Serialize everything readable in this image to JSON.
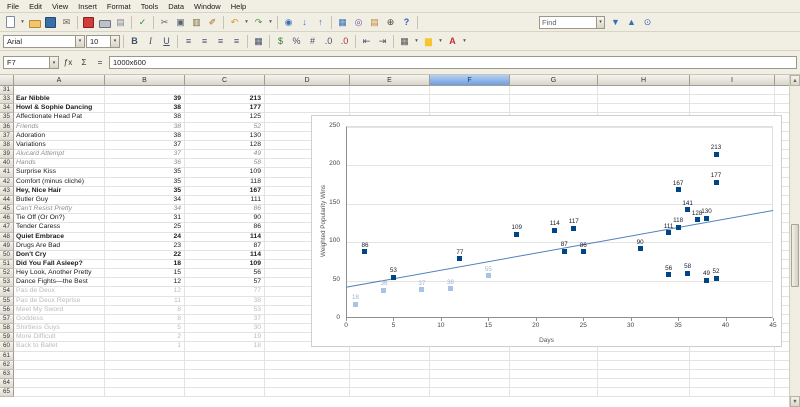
{
  "menubar": {
    "items": [
      "File",
      "Edit",
      "View",
      "Insert",
      "Format",
      "Tools",
      "Data",
      "Window",
      "Help"
    ]
  },
  "toolbar_standard": {
    "find_value": "Find",
    "icons": [
      {
        "name": "new-document-icon",
        "shape": "ic-page"
      },
      {
        "name": "new-document-dropdown-arrow",
        "glyph": "▾",
        "cls": "dd"
      },
      {
        "name": "open-icon",
        "shape": "ic-folder"
      },
      {
        "name": "save-icon",
        "shape": "ic-disk"
      },
      {
        "name": "document-as-email-icon",
        "glyph": "✉",
        "color": "#6b6254"
      },
      {
        "separator": true
      },
      {
        "name": "export-pdf-icon",
        "shape": "ic-pdf"
      },
      {
        "name": "print-icon",
        "shape": "ic-print"
      },
      {
        "name": "page-preview-icon",
        "glyph": "▤",
        "color": "#7d8697"
      },
      {
        "separator": true
      },
      {
        "name": "spellcheck-icon",
        "glyph": "✓",
        "color": "#2f8f2f"
      },
      {
        "separator": true
      },
      {
        "name": "cut-icon",
        "glyph": "✂",
        "color": "#5a6270"
      },
      {
        "name": "copy-icon",
        "glyph": "▣",
        "color": "#5a6270"
      },
      {
        "name": "paste-icon",
        "glyph": "▥",
        "color": "#7a6a3a"
      },
      {
        "name": "format-paintbrush-icon",
        "glyph": "✐",
        "color": "#a06a28"
      },
      {
        "separator": true
      },
      {
        "name": "undo-icon",
        "glyph": "↶",
        "color": "#d09c18"
      },
      {
        "name": "undo-dropdown-arrow",
        "glyph": "▾",
        "cls": "dd"
      },
      {
        "name": "redo-icon",
        "glyph": "↷",
        "color": "#3f9c3f"
      },
      {
        "name": "redo-dropdown-arrow",
        "glyph": "▾",
        "cls": "dd"
      },
      {
        "separator": true
      },
      {
        "name": "hyperlink-icon",
        "glyph": "◉",
        "color": "#3a6fb8"
      },
      {
        "name": "sort-ascending-icon",
        "glyph": "↓",
        "color": "#3a6fb8"
      },
      {
        "name": "sort-descending-icon",
        "glyph": "↑",
        "color": "#3a6fb8"
      },
      {
        "separator": true
      },
      {
        "name": "insert-chart-icon",
        "glyph": "▦",
        "color": "#3a6fb8"
      },
      {
        "name": "navigator-icon",
        "glyph": "◎",
        "color": "#7a4aa0"
      },
      {
        "name": "gallery-icon",
        "glyph": "▤",
        "color": "#b8893a"
      },
      {
        "name": "zoom-icon",
        "glyph": "⊕",
        "color": "#444444"
      },
      {
        "name": "help-icon",
        "glyph": "?",
        "color": "#2a5fd0",
        "cls": "b"
      },
      {
        "separator": true
      }
    ],
    "find_buttons": [
      {
        "name": "find-next-icon",
        "glyph": "▼",
        "color": "#3a6fb8"
      },
      {
        "name": "find-previous-icon",
        "glyph": "▲",
        "color": "#3a6fb8"
      },
      {
        "name": "find-and-replace-icon",
        "glyph": "⊙",
        "color": "#3a6fb8"
      }
    ]
  },
  "toolbar_formatting": {
    "font_name": "Arial",
    "font_size": "10",
    "icons": [
      {
        "name": "bold-button",
        "glyph": "B",
        "cls": "b"
      },
      {
        "name": "italic-button",
        "glyph": "I",
        "cls": "i"
      },
      {
        "name": "underline-button",
        "glyph": "U",
        "cls": "u"
      },
      {
        "separator": true
      },
      {
        "name": "align-left-button",
        "glyph": "≡"
      },
      {
        "name": "align-center-button",
        "glyph": "≡"
      },
      {
        "name": "align-right-button",
        "glyph": "≡"
      },
      {
        "name": "align-justify-button",
        "glyph": "≡"
      },
      {
        "separator": true
      },
      {
        "name": "merge-cells-button",
        "glyph": "▦"
      },
      {
        "separator": true
      },
      {
        "name": "currency-format-button",
        "glyph": "$",
        "color": "#3a7a3a"
      },
      {
        "name": "percent-format-button",
        "glyph": "%"
      },
      {
        "name": "standard-format-button",
        "glyph": "#"
      },
      {
        "name": "add-decimal-button",
        "glyph": ".0"
      },
      {
        "name": "delete-decimal-button",
        "glyph": ".0",
        "color": "#a33333"
      },
      {
        "separator": true
      },
      {
        "name": "decrease-indent-button",
        "glyph": "⇤"
      },
      {
        "name": "increase-indent-button",
        "glyph": "⇥"
      },
      {
        "separator": true
      },
      {
        "name": "borders-button",
        "glyph": "▦",
        "color": "#555555"
      },
      {
        "name": "borders-dropdown-arrow",
        "glyph": "▾",
        "cls": "dd"
      },
      {
        "name": "background-color-button",
        "glyph": "▆",
        "color": "#f7c52f"
      },
      {
        "name": "background-color-dropdown-arrow",
        "glyph": "▾",
        "cls": "dd"
      },
      {
        "name": "font-color-button",
        "glyph": "A",
        "color": "#c03030",
        "cls": "b"
      },
      {
        "name": "font-color-dropdown-arrow",
        "glyph": "▾",
        "cls": "dd"
      }
    ]
  },
  "formula_bar": {
    "cell_ref": "F7",
    "fx_label": "ƒx",
    "sum_label": "Σ",
    "equals_label": "=",
    "input_value": "1000x600"
  },
  "grid": {
    "columns": [
      "A",
      "B",
      "C",
      "D",
      "E",
      "F",
      "G",
      "H",
      "I"
    ],
    "selected_column": "F",
    "rows": [
      {
        "n": "31",
        "a": "",
        "b": "",
        "c": "",
        "style": "normal"
      },
      {
        "n": "33",
        "a": "Ear Nibble",
        "b": "39",
        "c": "213",
        "style": "bold"
      },
      {
        "n": "34",
        "a": "Howl & Sophie Dancing",
        "b": "38",
        "c": "177",
        "style": "bold"
      },
      {
        "n": "35",
        "a": "Affectionate Head Pat",
        "b": "38",
        "c": "125",
        "style": "normal"
      },
      {
        "n": "36",
        "a": "Friends",
        "b": "38",
        "c": "52",
        "style": "italic"
      },
      {
        "n": "37",
        "a": "Adoration",
        "b": "38",
        "c": "130",
        "style": "normal"
      },
      {
        "n": "38",
        "a": "Variations",
        "b": "37",
        "c": "128",
        "style": "normal"
      },
      {
        "n": "39",
        "a": "Alucard Attempt",
        "b": "37",
        "c": "49",
        "style": "italic"
      },
      {
        "n": "40",
        "a": "Hands",
        "b": "36",
        "c": "58",
        "style": "italic"
      },
      {
        "n": "41",
        "a": "Surprise Kiss",
        "b": "35",
        "c": "109",
        "style": "normal"
      },
      {
        "n": "42",
        "a": "Comfort (minus cliché)",
        "b": "35",
        "c": "118",
        "style": "normal"
      },
      {
        "n": "43",
        "a": "Hey, Nice Hair",
        "b": "35",
        "c": "167",
        "style": "bold"
      },
      {
        "n": "44",
        "a": "Butler Guy",
        "b": "34",
        "c": "111",
        "style": "normal"
      },
      {
        "n": "45",
        "a": "Can't Resist Pretty",
        "b": "34",
        "c": "86",
        "style": "italic"
      },
      {
        "n": "46",
        "a": "Tie Off (Or On?)",
        "b": "31",
        "c": "90",
        "style": "normal"
      },
      {
        "n": "47",
        "a": "Tender Caress",
        "b": "25",
        "c": "86",
        "style": "normal"
      },
      {
        "n": "48",
        "a": "Quiet Embrace",
        "b": "24",
        "c": "114",
        "style": "bold"
      },
      {
        "n": "49",
        "a": "Drugs Are Bad",
        "b": "23",
        "c": "87",
        "style": "normal"
      },
      {
        "n": "50",
        "a": "Don't Cry",
        "b": "22",
        "c": "114",
        "style": "bold"
      },
      {
        "n": "51",
        "a": "Did You Fall Asleep?",
        "b": "18",
        "c": "109",
        "style": "bold"
      },
      {
        "n": "52",
        "a": "Hey Look, Another Pretty",
        "b": "15",
        "c": "56",
        "style": "normal"
      },
      {
        "n": "53",
        "a": "Dance Fights—the Best",
        "b": "12",
        "c": "57",
        "style": "normal"
      },
      {
        "n": "54",
        "a": "Pas de Deux",
        "b": "12",
        "c": "77",
        "style": "faded"
      },
      {
        "n": "55",
        "a": "Pas de Deux Reprise",
        "b": "11",
        "c": "38",
        "style": "faded"
      },
      {
        "n": "56",
        "a": "Meet My Sword",
        "b": "8",
        "c": "53",
        "style": "faded"
      },
      {
        "n": "57",
        "a": "Goddess",
        "b": "8",
        "c": "37",
        "style": "faded"
      },
      {
        "n": "58",
        "a": "Shirtless Guys",
        "b": "5",
        "c": "30",
        "style": "faded"
      },
      {
        "n": "59",
        "a": "More Difficult",
        "b": "2",
        "c": "19",
        "style": "faded"
      },
      {
        "n": "60",
        "a": "Back to Ballet",
        "b": "1",
        "c": "18",
        "style": "faded"
      },
      {
        "n": "61",
        "a": "",
        "b": "",
        "c": "",
        "style": "normal"
      },
      {
        "n": "62",
        "a": "",
        "b": "",
        "c": "",
        "style": "normal"
      },
      {
        "n": "63",
        "a": "",
        "b": "",
        "c": "",
        "style": "normal"
      },
      {
        "n": "64",
        "a": "",
        "b": "",
        "c": "",
        "style": "normal"
      },
      {
        "n": "65",
        "a": "",
        "b": "",
        "c": "",
        "style": "normal"
      }
    ]
  },
  "chart_data": {
    "type": "scatter",
    "title": "",
    "xlabel": "Days",
    "ylabel": "Weighted Popularity Wins",
    "xlim": [
      0,
      45
    ],
    "ylim": [
      0,
      250
    ],
    "xticks": [
      0,
      5,
      10,
      15,
      20,
      25,
      30,
      35,
      40,
      45
    ],
    "yticks": [
      0,
      50,
      100,
      150,
      200,
      250
    ],
    "grid": true,
    "legend": false,
    "series": [
      {
        "name": "main",
        "color": "#004586",
        "label_color": "#1a1a2e",
        "points": [
          {
            "x": 2,
            "y": 86
          },
          {
            "x": 5,
            "y": 53
          },
          {
            "x": 12,
            "y": 77
          },
          {
            "x": 18,
            "y": 109
          },
          {
            "x": 22,
            "y": 114
          },
          {
            "x": 23,
            "y": 87
          },
          {
            "x": 24,
            "y": 117
          },
          {
            "x": 25,
            "y": 86
          },
          {
            "x": 31,
            "y": 90
          },
          {
            "x": 34,
            "y": 111
          },
          {
            "x": 34,
            "y": 56
          },
          {
            "x": 35,
            "y": 118
          },
          {
            "x": 35,
            "y": 167
          },
          {
            "x": 36,
            "y": 141
          },
          {
            "x": 36,
            "y": 58
          },
          {
            "x": 37,
            "y": 128
          },
          {
            "x": 38,
            "y": 130
          },
          {
            "x": 38,
            "y": 49
          },
          {
            "x": 39,
            "y": 177
          },
          {
            "x": 39,
            "y": 213
          },
          {
            "x": 39,
            "y": 52
          }
        ]
      },
      {
        "name": "secondary",
        "color": "#a6c5e6",
        "label_color": "#9fb4c8",
        "points": [
          {
            "x": 1,
            "y": 18
          },
          {
            "x": 4,
            "y": 36
          },
          {
            "x": 8,
            "y": 37
          },
          {
            "x": 11,
            "y": 38
          },
          {
            "x": 15,
            "y": 55
          }
        ]
      }
    ],
    "trendline": {
      "x1": 0,
      "y1": 40,
      "x2": 45,
      "y2": 140,
      "color": "#4f81bd"
    }
  }
}
